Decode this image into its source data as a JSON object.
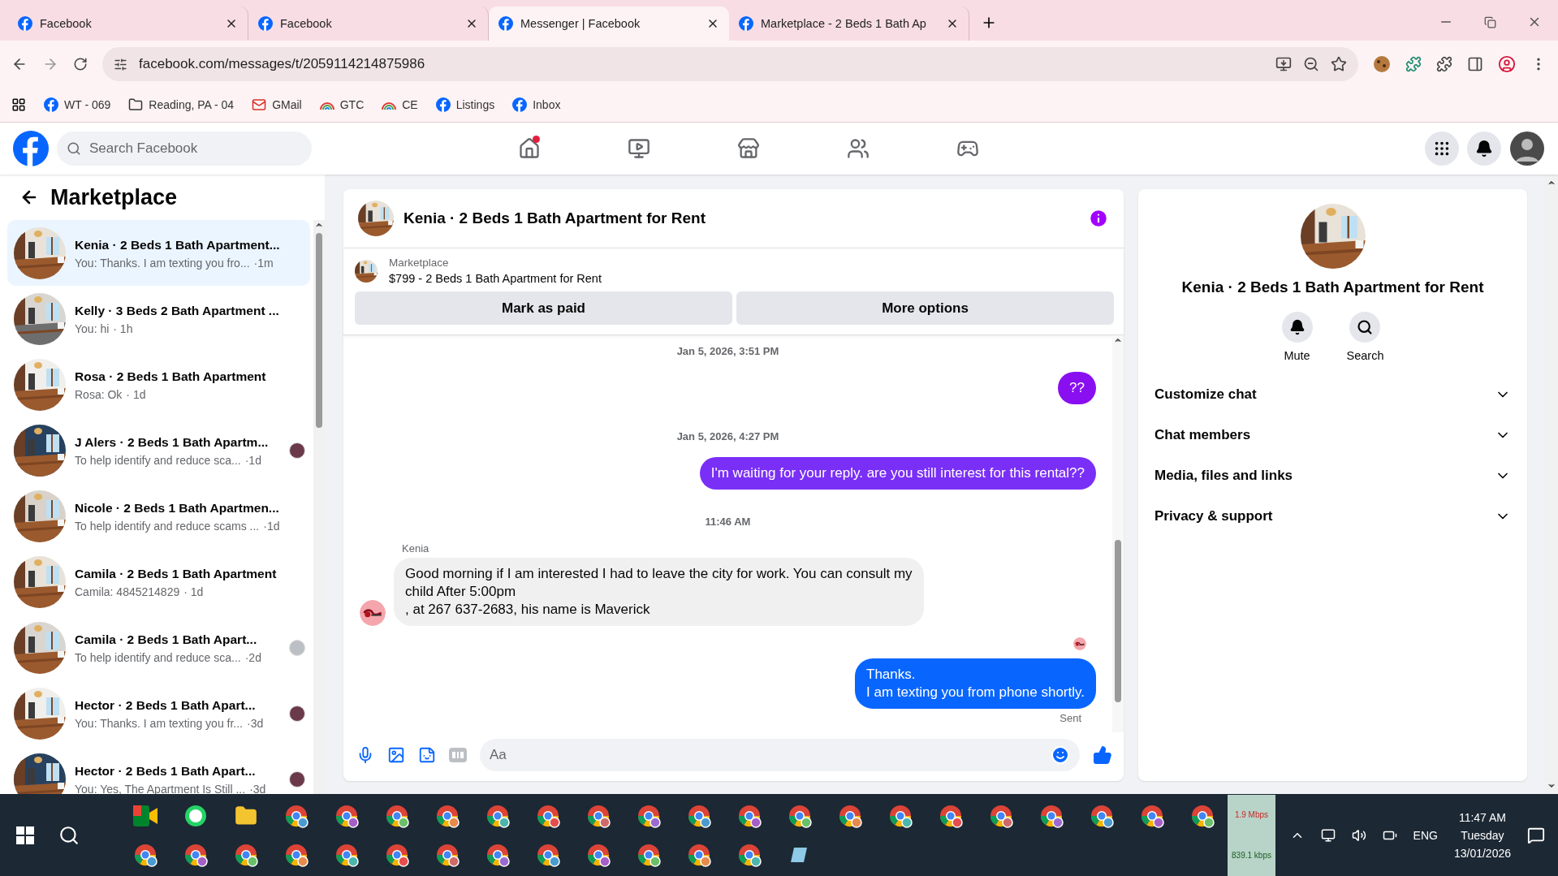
{
  "browser": {
    "tabs": [
      {
        "title": "Facebook",
        "selected": false
      },
      {
        "title": "Facebook",
        "selected": false
      },
      {
        "title": "Messenger | Facebook",
        "selected": true
      },
      {
        "title": "Marketplace - 2 Beds 1 Bath Ap",
        "selected": false
      }
    ],
    "url": "facebook.com/messages/t/2059114214875986",
    "bookmarks": [
      {
        "label": "WT - 069",
        "kind": "facebook"
      },
      {
        "label": "Reading, PA - 04",
        "kind": "folder"
      },
      {
        "label": "GMail",
        "kind": "gmail"
      },
      {
        "label": "GTC",
        "kind": "rainbow"
      },
      {
        "label": "CE",
        "kind": "rainbow"
      },
      {
        "label": "Listings",
        "kind": "facebook"
      },
      {
        "label": "Inbox",
        "kind": "facebook"
      }
    ]
  },
  "facebook": {
    "search": {
      "placeholder": "Search Facebook"
    },
    "nav": [
      {
        "kind": "home",
        "notification": true
      },
      {
        "kind": "video",
        "notification": false
      },
      {
        "kind": "marketplace",
        "notification": false
      },
      {
        "kind": "groups",
        "notification": false
      },
      {
        "kind": "gaming",
        "notification": false
      }
    ]
  },
  "sidebar": {
    "title": "Marketplace",
    "conversations": [
      {
        "title": "Kenia · 2 Beds 1 Bath Apartment...",
        "preview": "You: Thanks. I am texting you fro...",
        "time": "·1m",
        "selected": true
      },
      {
        "title": "Kelly · 3 Beds 2 Bath Apartment ...",
        "preview": "You: hi",
        "time": "· 1h",
        "selected": false
      },
      {
        "title": "Rosa · 2 Beds 1 Bath Apartment",
        "preview": "Rosa: Ok",
        "time": "· 1d",
        "selected": false
      },
      {
        "title": "J Alers · 2 Beds 1 Bath Apartm...",
        "preview": "To help identify and reduce sca...",
        "time": "·1d",
        "selected": false
      },
      {
        "title": "Nicole · 2 Beds 1 Bath Apartmen...",
        "preview": "To help identify and reduce scams ...",
        "time": "·1d",
        "selected": false
      },
      {
        "title": "Camila · 2 Beds 1 Bath Apartment",
        "preview": "Camila: 4845214829",
        "time": "· 1d",
        "selected": false
      },
      {
        "title": "Camila · 2 Beds 1 Bath Apart...",
        "preview": "To help identify and reduce sca...",
        "time": "·2d",
        "selected": false,
        "seen": {
          "kind": "placeholder"
        }
      },
      {
        "title": "Hector · 2 Beds 1 Bath Apart...",
        "preview": "You: Thanks. I am texting you fr...",
        "time": "·3d",
        "selected": false
      },
      {
        "title": "Hector · 2 Beds 1 Bath Apart...",
        "preview": "You: Yes, The Apartment Is Still ...",
        "time": "·3d",
        "selected": false
      }
    ]
  },
  "chat": {
    "title": "Kenia · 2 Beds 1 Bath Apartment for Rent",
    "listing": {
      "label": "Marketplace",
      "text": "$799 - 2 Beds 1 Bath Apartment for Rent"
    },
    "actions": [
      "Mark as paid",
      "More options"
    ],
    "messages": [
      {
        "kind": "time",
        "text": "Jan 5, 2026, 3:51 PM"
      },
      {
        "kind": "outgoing",
        "text": "??",
        "color": "#8a0ff0"
      },
      {
        "kind": "time",
        "text": "Jan 5, 2026, 4:27 PM"
      },
      {
        "kind": "outgoing",
        "text": "I'm waiting for your reply. are you still interest for this rental??",
        "color": "#7a2ff6"
      },
      {
        "kind": "time",
        "text": "11:46 AM"
      },
      {
        "kind": "incoming",
        "sender": "Kenia",
        "text": "Good morning if I am interested I had to leave the city for work. You can consult my\nchild After 5:00pm\n, at 267 637-2683, his name is Maverick"
      },
      {
        "kind": "outgoing",
        "text": "Thanks.\nI am texting you from phone shortly.",
        "color": "#0866ff",
        "seen": true
      }
    ],
    "status": "Sent",
    "composer": {
      "placeholder": "Aa"
    }
  },
  "details": {
    "title": "Kenia · 2 Beds 1 Bath Apartment for Rent",
    "actions": [
      {
        "kind": "mute",
        "label": "Mute"
      },
      {
        "kind": "search",
        "label": "Search"
      }
    ],
    "sections": [
      {
        "label": "Customize chat",
        "expanded": false
      },
      {
        "label": "Chat members",
        "expanded": false
      },
      {
        "label": "Media, files and links",
        "expanded": false
      },
      {
        "label": "Privacy & support",
        "expanded": false
      }
    ]
  },
  "taskbar": {
    "network": {
      "down": "1.9 Mbps",
      "up": "839.1 kbps"
    },
    "language": "ENG",
    "time": "11:47 AM",
    "day": "Tuesday",
    "date": "13/01/2026"
  }
}
